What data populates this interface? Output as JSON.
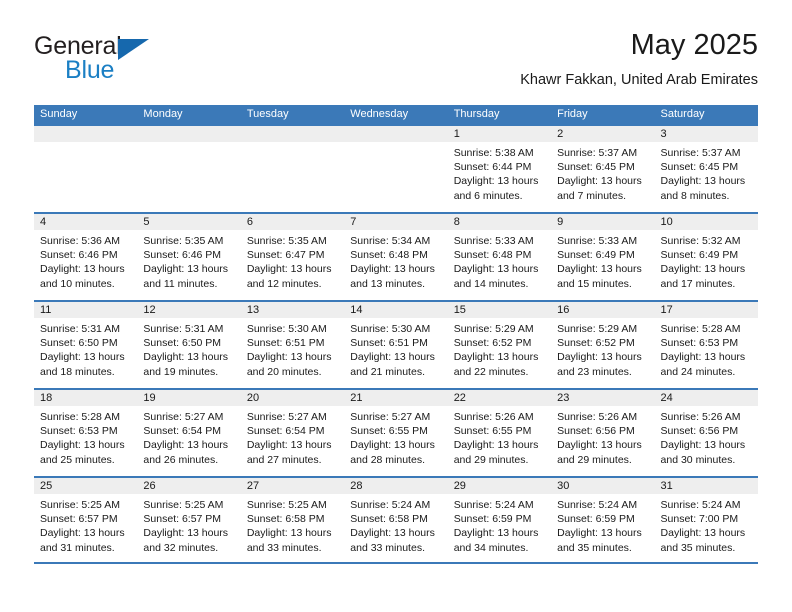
{
  "brand": {
    "name_top": "General",
    "name_bottom": "Blue",
    "triangle_icon": "blue-triangle-icon",
    "accent_color": "#1b7fc4"
  },
  "header": {
    "title": "May 2025",
    "subtitle": "Khawr Fakkan, United Arab Emirates"
  },
  "theme": {
    "header_bar_color": "#3b79b8",
    "day_number_band_color": "#eeeeee",
    "text_color": "#1a1a1a"
  },
  "weekdays": [
    "Sunday",
    "Monday",
    "Tuesday",
    "Wednesday",
    "Thursday",
    "Friday",
    "Saturday"
  ],
  "weeks": [
    [
      {
        "day": "",
        "lines": []
      },
      {
        "day": "",
        "lines": []
      },
      {
        "day": "",
        "lines": []
      },
      {
        "day": "",
        "lines": []
      },
      {
        "day": "1",
        "lines": [
          "Sunrise: 5:38 AM",
          "Sunset: 6:44 PM",
          "Daylight: 13 hours",
          "and 6 minutes."
        ]
      },
      {
        "day": "2",
        "lines": [
          "Sunrise: 5:37 AM",
          "Sunset: 6:45 PM",
          "Daylight: 13 hours",
          "and 7 minutes."
        ]
      },
      {
        "day": "3",
        "lines": [
          "Sunrise: 5:37 AM",
          "Sunset: 6:45 PM",
          "Daylight: 13 hours",
          "and 8 minutes."
        ]
      }
    ],
    [
      {
        "day": "4",
        "lines": [
          "Sunrise: 5:36 AM",
          "Sunset: 6:46 PM",
          "Daylight: 13 hours",
          "and 10 minutes."
        ]
      },
      {
        "day": "5",
        "lines": [
          "Sunrise: 5:35 AM",
          "Sunset: 6:46 PM",
          "Daylight: 13 hours",
          "and 11 minutes."
        ]
      },
      {
        "day": "6",
        "lines": [
          "Sunrise: 5:35 AM",
          "Sunset: 6:47 PM",
          "Daylight: 13 hours",
          "and 12 minutes."
        ]
      },
      {
        "day": "7",
        "lines": [
          "Sunrise: 5:34 AM",
          "Sunset: 6:48 PM",
          "Daylight: 13 hours",
          "and 13 minutes."
        ]
      },
      {
        "day": "8",
        "lines": [
          "Sunrise: 5:33 AM",
          "Sunset: 6:48 PM",
          "Daylight: 13 hours",
          "and 14 minutes."
        ]
      },
      {
        "day": "9",
        "lines": [
          "Sunrise: 5:33 AM",
          "Sunset: 6:49 PM",
          "Daylight: 13 hours",
          "and 15 minutes."
        ]
      },
      {
        "day": "10",
        "lines": [
          "Sunrise: 5:32 AM",
          "Sunset: 6:49 PM",
          "Daylight: 13 hours",
          "and 17 minutes."
        ]
      }
    ],
    [
      {
        "day": "11",
        "lines": [
          "Sunrise: 5:31 AM",
          "Sunset: 6:50 PM",
          "Daylight: 13 hours",
          "and 18 minutes."
        ]
      },
      {
        "day": "12",
        "lines": [
          "Sunrise: 5:31 AM",
          "Sunset: 6:50 PM",
          "Daylight: 13 hours",
          "and 19 minutes."
        ]
      },
      {
        "day": "13",
        "lines": [
          "Sunrise: 5:30 AM",
          "Sunset: 6:51 PM",
          "Daylight: 13 hours",
          "and 20 minutes."
        ]
      },
      {
        "day": "14",
        "lines": [
          "Sunrise: 5:30 AM",
          "Sunset: 6:51 PM",
          "Daylight: 13 hours",
          "and 21 minutes."
        ]
      },
      {
        "day": "15",
        "lines": [
          "Sunrise: 5:29 AM",
          "Sunset: 6:52 PM",
          "Daylight: 13 hours",
          "and 22 minutes."
        ]
      },
      {
        "day": "16",
        "lines": [
          "Sunrise: 5:29 AM",
          "Sunset: 6:52 PM",
          "Daylight: 13 hours",
          "and 23 minutes."
        ]
      },
      {
        "day": "17",
        "lines": [
          "Sunrise: 5:28 AM",
          "Sunset: 6:53 PM",
          "Daylight: 13 hours",
          "and 24 minutes."
        ]
      }
    ],
    [
      {
        "day": "18",
        "lines": [
          "Sunrise: 5:28 AM",
          "Sunset: 6:53 PM",
          "Daylight: 13 hours",
          "and 25 minutes."
        ]
      },
      {
        "day": "19",
        "lines": [
          "Sunrise: 5:27 AM",
          "Sunset: 6:54 PM",
          "Daylight: 13 hours",
          "and 26 minutes."
        ]
      },
      {
        "day": "20",
        "lines": [
          "Sunrise: 5:27 AM",
          "Sunset: 6:54 PM",
          "Daylight: 13 hours",
          "and 27 minutes."
        ]
      },
      {
        "day": "21",
        "lines": [
          "Sunrise: 5:27 AM",
          "Sunset: 6:55 PM",
          "Daylight: 13 hours",
          "and 28 minutes."
        ]
      },
      {
        "day": "22",
        "lines": [
          "Sunrise: 5:26 AM",
          "Sunset: 6:55 PM",
          "Daylight: 13 hours",
          "and 29 minutes."
        ]
      },
      {
        "day": "23",
        "lines": [
          "Sunrise: 5:26 AM",
          "Sunset: 6:56 PM",
          "Daylight: 13 hours",
          "and 29 minutes."
        ]
      },
      {
        "day": "24",
        "lines": [
          "Sunrise: 5:26 AM",
          "Sunset: 6:56 PM",
          "Daylight: 13 hours",
          "and 30 minutes."
        ]
      }
    ],
    [
      {
        "day": "25",
        "lines": [
          "Sunrise: 5:25 AM",
          "Sunset: 6:57 PM",
          "Daylight: 13 hours",
          "and 31 minutes."
        ]
      },
      {
        "day": "26",
        "lines": [
          "Sunrise: 5:25 AM",
          "Sunset: 6:57 PM",
          "Daylight: 13 hours",
          "and 32 minutes."
        ]
      },
      {
        "day": "27",
        "lines": [
          "Sunrise: 5:25 AM",
          "Sunset: 6:58 PM",
          "Daylight: 13 hours",
          "and 33 minutes."
        ]
      },
      {
        "day": "28",
        "lines": [
          "Sunrise: 5:24 AM",
          "Sunset: 6:58 PM",
          "Daylight: 13 hours",
          "and 33 minutes."
        ]
      },
      {
        "day": "29",
        "lines": [
          "Sunrise: 5:24 AM",
          "Sunset: 6:59 PM",
          "Daylight: 13 hours",
          "and 34 minutes."
        ]
      },
      {
        "day": "30",
        "lines": [
          "Sunrise: 5:24 AM",
          "Sunset: 6:59 PM",
          "Daylight: 13 hours",
          "and 35 minutes."
        ]
      },
      {
        "day": "31",
        "lines": [
          "Sunrise: 5:24 AM",
          "Sunset: 7:00 PM",
          "Daylight: 13 hours",
          "and 35 minutes."
        ]
      }
    ]
  ]
}
